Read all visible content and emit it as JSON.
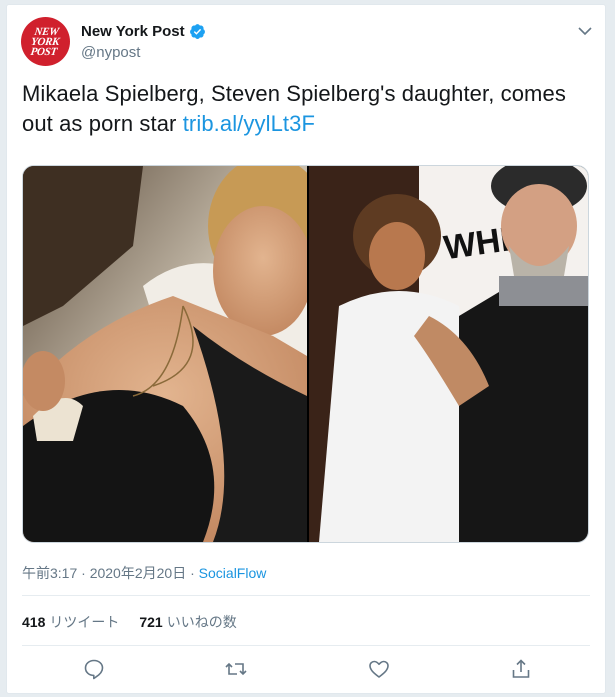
{
  "account": {
    "avatar_lines": [
      "NEW",
      "YORK",
      "POST"
    ],
    "display_name": "New York Post",
    "handle": "@nypost"
  },
  "tweet": {
    "text": "Mikaela Spielberg, Steven Spielberg's daughter, comes out as porn star",
    "link": "trib.al/yylLt3F"
  },
  "media": {
    "left_sign_text": "WHIP I"
  },
  "meta": {
    "time": "午前3:17",
    "separator": "·",
    "date": "2020年2月20日",
    "source": "SocialFlow"
  },
  "stats": {
    "retweets_count": "418",
    "retweets_label": "リツイート",
    "likes_count": "721",
    "likes_label": "いいねの数"
  },
  "icons": {
    "reply": "reply-icon",
    "retweet": "retweet-icon",
    "like": "like-icon",
    "share": "share-icon",
    "caret": "chevron-down-icon",
    "verified": "verified-badge-icon"
  },
  "colors": {
    "brand_red": "#d0202d",
    "link_blue": "#1b95e0",
    "muted": "#657786"
  }
}
